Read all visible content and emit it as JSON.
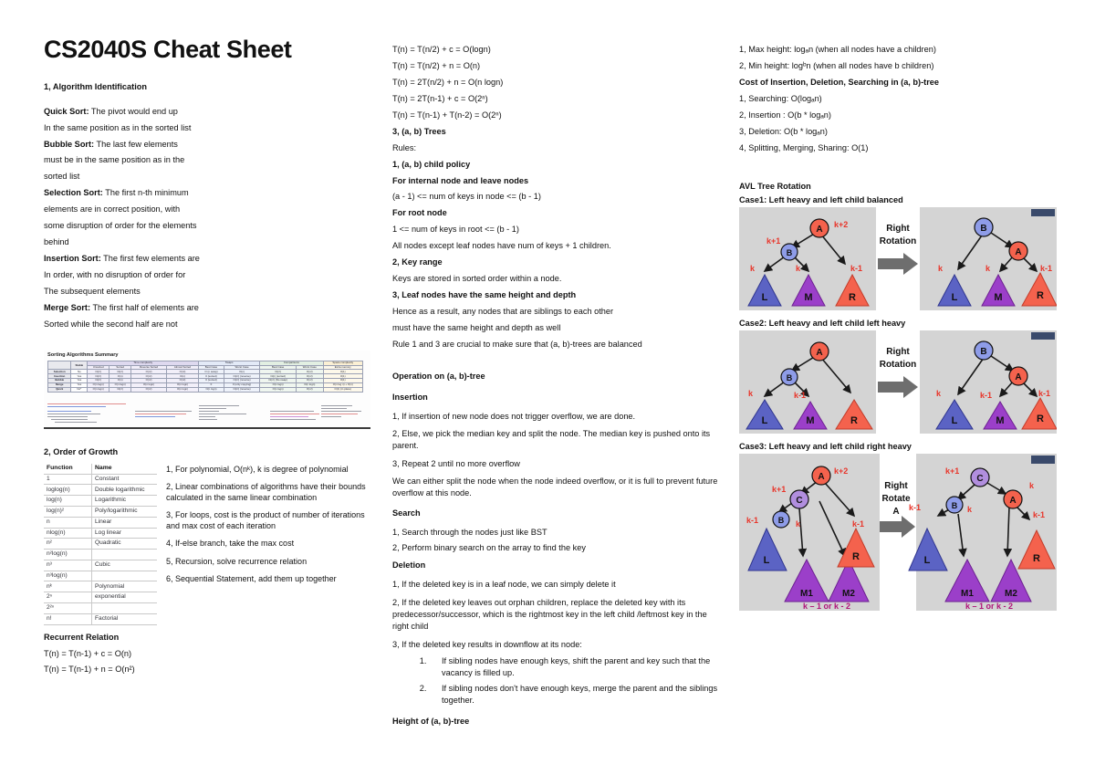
{
  "title": "CS2040S Cheat Sheet",
  "left": {
    "section1_heading": "1, Algorithm Identification",
    "algos": [
      {
        "name": "Quick Sort:",
        "rest": " The pivot would end up",
        "cont": [
          "In the same position as in the sorted list"
        ]
      },
      {
        "name": "Bubble Sort:",
        "rest": " The last few elements",
        "cont": [
          "must be in the same position as in the",
          "sorted list"
        ]
      },
      {
        "name": "Selection Sort:",
        "rest": " The first n-th minimum",
        "cont": [
          " elements are in correct position, with",
          "some disruption of  order for the elements",
          "behind"
        ]
      },
      {
        "name": "Insertion Sort:",
        "rest": " The first few elements are",
        "cont": [
          "In order, with no disruption of order for",
          "The subsequent elements"
        ]
      },
      {
        "name": "Merge Sort:",
        "rest": " The first half of elements are",
        "cont": [
          "Sorted while the second half are not"
        ]
      }
    ],
    "sort_table": {
      "caption": "Sorting Algorithms Summary",
      "group_headers": [
        "",
        "Stable",
        "Time complexity",
        "Swaps",
        "Comparisons",
        "Space complexity"
      ],
      "sub_headers": [
        "",
        "Stable",
        "Unsorted",
        "Sorted",
        "Reverse Sorted",
        "Almost Sorted",
        "Best Case",
        "Worst Case",
        "Best Case",
        "Worst Case",
        "Extra memory"
      ],
      "rows": [
        {
          "name": "Selection",
          "cells": [
            "No",
            "O(n²)",
            "O(n²)",
            "O(n²)",
            "O(n²)",
            "O (n swap)",
            "O(n)",
            "O(n²)",
            "O(n²)",
            "O(1)"
          ]
        },
        {
          "name": "Insertion",
          "cells": [
            "Yes",
            "O(n²)",
            "O(n)",
            "O(n²)",
            "O(n)",
            "0 (sorted)",
            "O(n²) (reverse)",
            "O(n) (sorted)",
            "O(n²)",
            "O(1)"
          ]
        },
        {
          "name": "Bubble",
          "cells": [
            "Yes",
            "O(n²)",
            "O(n)",
            "O(n²)",
            "O(n²)",
            "0 (sorted)",
            "O(n²) (reverse)",
            "O(n²) (No swap)",
            "O(n²)",
            "O(1)"
          ]
        },
        {
          "name": "Merge",
          "cells": [
            "Yes",
            "O(n logn)",
            "O(n logn)",
            "O(n logn)",
            "O(n logn)",
            "0",
            "0 (only copying)",
            "O(n logn)",
            "O(n logn)",
            "O(n log n) + O(n)"
          ]
        },
        {
          "name": "Quick",
          "cells": [
            "No*",
            "O(n logn)",
            "O(n²)",
            "O(n²)",
            "O(n logn)",
            "O(n logn)",
            "O(n²) (reverse)",
            "O(n logn)",
            "O(n²)",
            "O(1) (in place)"
          ]
        }
      ],
      "footnote": "*No (but it is possible to make it stable by using extra memory)"
    },
    "section2_heading": "2, Order of Growth",
    "growth_table": {
      "headers": [
        "Function",
        "Name"
      ],
      "rows": [
        [
          "1",
          "Constant"
        ],
        [
          "loglog(n)",
          "Double logarithmic"
        ],
        [
          "log(n)",
          "Logarithmic"
        ],
        [
          "log(n)²",
          "Poly/logarithmic"
        ],
        [
          "n",
          "Linear"
        ],
        [
          "nlog(n)",
          "Log linear"
        ],
        [
          "n²",
          "Quadratic"
        ],
        [
          "n²log(n)",
          ""
        ],
        [
          "n³",
          "Cubic"
        ],
        [
          "n³log(n)",
          ""
        ],
        [
          "nᵏ",
          "Polynomial"
        ],
        [
          "2ⁿ",
          "exponential"
        ],
        [
          "2²ⁿ",
          ""
        ],
        [
          "n!",
          "Factorial"
        ]
      ]
    },
    "growth_notes": [
      "1, For polynomial, O(nᵏ), k is degree of polynomial",
      "2, Linear combinations of algorithms have their bounds calculated in the same linear combination",
      "3, For loops, cost is the product of number of iterations and max cost of each iteration",
      "4, If-else branch, take the max cost",
      "5, Recursion, solve recurrence relation",
      "6, Sequential Statement, add them up together"
    ],
    "recurrent_heading": "Recurrent Relation",
    "recurrent": [
      "T(n) = T(n-1) + c = O(n)",
      "T(n) = T(n-1) + n = O(n²)"
    ]
  },
  "mid": {
    "recurrences": [
      "T(n) = T(n/2) + c = O(logn)",
      "T(n) = T(n/2) + n = O(n)",
      "T(n) = 2T(n/2) + n = O(n logn)",
      "T(n) = 2T(n-1) + c = O(2ⁿ)",
      "T(n) = T(n-1) + T(n-2) = O(2ⁿ)"
    ],
    "trees_heading": "3, (a, b) Trees",
    "rules_label": "Rules:",
    "rule1_heading": "1, (a, b) child policy",
    "rule1_lines": [
      {
        "text": "For internal node and leave nodes",
        "bold": true
      },
      {
        "text": "(a - 1) <= num of keys in node <= (b - 1)",
        "bold": false
      },
      {
        "text": "For root node",
        "bold": true
      },
      {
        "text": "1 <= num of keys in root <= (b - 1)",
        "bold": false
      },
      {
        "text": "All nodes except leaf nodes have num of keys + 1 children.",
        "bold": false
      }
    ],
    "rule2_heading": "2, Key range",
    "rule2_lines": [
      {
        "text": "Keys are stored in sorted order within a node.",
        "bold": false
      }
    ],
    "rule3_heading": "3, Leaf nodes have the same height and depth",
    "rule3_lines": [
      {
        "text": "Hence as a result, any nodes that are siblings to each other",
        "bold": false
      },
      {
        "text": "must have the same height and depth as well",
        "bold": false
      },
      {
        "text": "Rule 1 and 3 are crucial to make sure that (a, b)-trees are balanced",
        "bold": false
      }
    ],
    "operation_heading": "Operation on (a, b)-tree",
    "insertion_heading": "Insertion",
    "insertion_items": [
      "1, If insertion of new node does not trigger overflow, we are done.",
      "2, Else, we pick the median key and split the node. The median key is pushed onto its parent.",
      "3, Repeat 2 until no more overflow",
      "We can either split the node when the node indeed overflow, or it is full to prevent future overflow at this node."
    ],
    "search_heading": "Search",
    "search_items": [
      "1, Search through the nodes just like BST",
      "2, Perform binary search on the array to find the key"
    ],
    "deletion_heading": "Deletion",
    "deletion_items": [
      "1, If the deleted key is in a leaf node, we can simply delete it",
      "2, If the deleted key leaves out orphan children, replace the deleted key with its predecessor/successor, which is the rightmost key in the left child /leftmost key in the right child",
      "3, If the deleted key results in downflow at its node:"
    ],
    "deletion_sub": [
      "If sibling nodes have enough keys, shift the parent and key such that the vacancy is filled up.",
      "If sibling nodes don't have enough keys, merge the parent and the siblings together."
    ],
    "height_heading": "Height of (a, b)-tree"
  },
  "right": {
    "height_items": [
      "1, Max height: logₐn (when all nodes have a children)",
      "2, Min height: logᵇn (when all nodes have b children)"
    ],
    "cost_heading": "Cost of Insertion, Deletion, Searching in (a, b)-tree",
    "cost_items": [
      "1, Searching: O(logₐn)",
      "2, Insertion : O(b * logₐn)",
      "3, Deletion: O(b *  logₐn)",
      "4, Splitting, Merging, Sharing: O(1)"
    ],
    "avl_heading": "AVL Tree Rotation",
    "cases": [
      {
        "label": "Case1: Left heavy and left child balanced",
        "action": [
          "Right",
          "Rotation"
        ],
        "before": {
          "root": "A",
          "left": "B",
          "triangles": [
            "L",
            "M",
            "R"
          ],
          "labels": {
            "root": "k+2",
            "left": "k+1",
            "t1": "k",
            "t2": "k",
            "t3": "k-1"
          }
        },
        "after": {
          "root": "B",
          "right": "A",
          "triangles": [
            "L",
            "M",
            "R"
          ],
          "labels": {
            "t1": "k",
            "t2": "k",
            "t3": "k-1"
          }
        }
      },
      {
        "label": "Case2: Left heavy and left child left heavy",
        "action": [
          "Right",
          "Rotation"
        ],
        "before": {
          "root": "A",
          "left": "B",
          "triangles": [
            "L",
            "M",
            "R"
          ],
          "labels": {
            "root": "",
            "left": "",
            "t1": "k",
            "t2": "k-1",
            "t3": ""
          }
        },
        "after": {
          "root": "B",
          "right": "A",
          "triangles": [
            "L",
            "M",
            "R"
          ],
          "labels": {
            "t1": "k",
            "t2": "k-1",
            "t3": "k-1"
          }
        }
      },
      {
        "label": "Case3: Left heavy and left child right heavy",
        "action": [
          "Right",
          "Rotate",
          "A"
        ],
        "before": {
          "root": "A",
          "mid": "C",
          "left": "B",
          "triangles": [
            "L",
            "M1",
            "M2",
            "R"
          ],
          "labels": {
            "root": "k+2",
            "mid": "k+1",
            "t1": "k-1",
            "t2": "k",
            "t3": "k-1"
          },
          "bottom": "k – 1 or k - 2"
        },
        "after": {
          "root": "C",
          "right": "A",
          "left": "B",
          "triangles": [
            "L",
            "M1",
            "M2",
            "R"
          ],
          "labels": {
            "root": "k+1",
            "right": "k",
            "t1": "k-1",
            "t2": "k",
            "t3": "k-1"
          },
          "bottom": "k – 1 or k - 2"
        }
      }
    ]
  },
  "colors": {
    "node_red": "#f4624d",
    "node_blue": "#8e9ce8",
    "node_purple": "#b18ede",
    "tri_blue": "#5b63c4",
    "tri_purple": "#9b3fc9",
    "tri_red": "#f4624d",
    "diagram_bg": "#d4d4d4",
    "label_red": "#e8352a",
    "arrow_gray": "#6e6e6e"
  }
}
